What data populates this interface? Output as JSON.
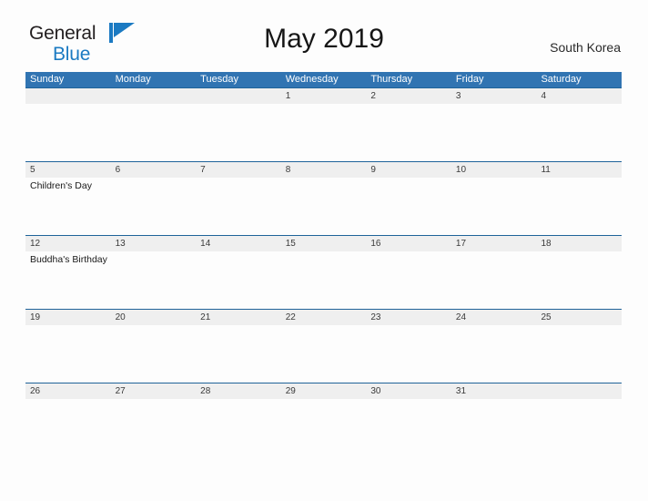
{
  "header": {
    "brand": {
      "name_part1": "General",
      "name_part2": "Blue",
      "mark_icon": "blue-flag-triangle-icon",
      "accent_color": "#1b7ac2"
    },
    "title": "May 2019",
    "region": "South Korea"
  },
  "calendar": {
    "header_bg_color": "#3174b2",
    "date_band_color": "#efefef",
    "row_border_color": "#1f6399",
    "weekdays": [
      "Sunday",
      "Monday",
      "Tuesday",
      "Wednesday",
      "Thursday",
      "Friday",
      "Saturday"
    ],
    "weeks": [
      {
        "days": [
          {
            "date": "",
            "events": []
          },
          {
            "date": "",
            "events": []
          },
          {
            "date": "",
            "events": []
          },
          {
            "date": "1",
            "events": []
          },
          {
            "date": "2",
            "events": []
          },
          {
            "date": "3",
            "events": []
          },
          {
            "date": "4",
            "events": []
          }
        ]
      },
      {
        "days": [
          {
            "date": "5",
            "events": [
              "Children's Day"
            ]
          },
          {
            "date": "6",
            "events": []
          },
          {
            "date": "7",
            "events": []
          },
          {
            "date": "8",
            "events": []
          },
          {
            "date": "9",
            "events": []
          },
          {
            "date": "10",
            "events": []
          },
          {
            "date": "11",
            "events": []
          }
        ]
      },
      {
        "days": [
          {
            "date": "12",
            "events": [
              "Buddha's Birthday"
            ]
          },
          {
            "date": "13",
            "events": []
          },
          {
            "date": "14",
            "events": []
          },
          {
            "date": "15",
            "events": []
          },
          {
            "date": "16",
            "events": []
          },
          {
            "date": "17",
            "events": []
          },
          {
            "date": "18",
            "events": []
          }
        ]
      },
      {
        "days": [
          {
            "date": "19",
            "events": []
          },
          {
            "date": "20",
            "events": []
          },
          {
            "date": "21",
            "events": []
          },
          {
            "date": "22",
            "events": []
          },
          {
            "date": "23",
            "events": []
          },
          {
            "date": "24",
            "events": []
          },
          {
            "date": "25",
            "events": []
          }
        ]
      },
      {
        "days": [
          {
            "date": "26",
            "events": []
          },
          {
            "date": "27",
            "events": []
          },
          {
            "date": "28",
            "events": []
          },
          {
            "date": "29",
            "events": []
          },
          {
            "date": "30",
            "events": []
          },
          {
            "date": "31",
            "events": []
          },
          {
            "date": "",
            "events": []
          }
        ]
      }
    ]
  }
}
